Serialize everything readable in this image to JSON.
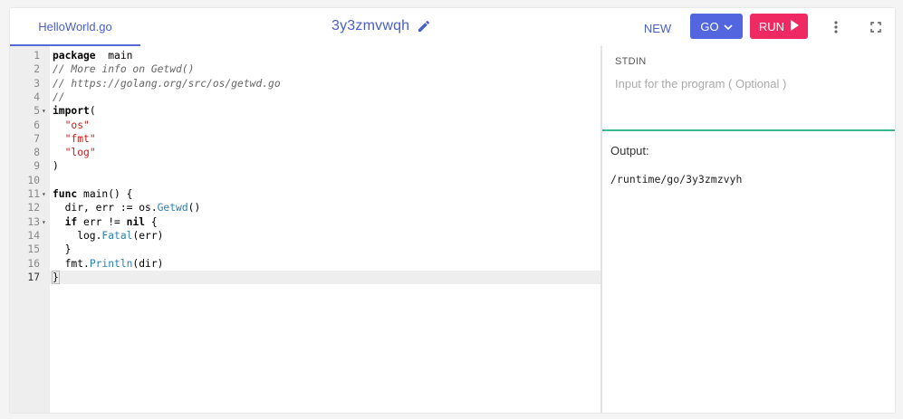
{
  "header": {
    "file_tab": "HelloWorld.go",
    "title": "3y3zmvwqh",
    "new_label": "NEW",
    "go_label": "GO",
    "run_label": "RUN"
  },
  "editor": {
    "active_line": 17,
    "lines": [
      {
        "n": "1",
        "fold": false,
        "tokens": [
          [
            "kw",
            "package"
          ],
          [
            "",
            "  main"
          ]
        ]
      },
      {
        "n": "2",
        "fold": false,
        "tokens": [
          [
            "cm",
            "// More info on Getwd()"
          ]
        ]
      },
      {
        "n": "3",
        "fold": false,
        "tokens": [
          [
            "cm",
            "// https://golang.org/src/os/getwd.go"
          ]
        ]
      },
      {
        "n": "4",
        "fold": false,
        "tokens": [
          [
            "cm",
            "//"
          ]
        ]
      },
      {
        "n": "5",
        "fold": true,
        "tokens": [
          [
            "kw",
            "import"
          ],
          [
            "",
            "("
          ]
        ]
      },
      {
        "n": "6",
        "fold": false,
        "tokens": [
          [
            "",
            "  "
          ],
          [
            "str",
            "\"os\""
          ]
        ]
      },
      {
        "n": "7",
        "fold": false,
        "tokens": [
          [
            "",
            "  "
          ],
          [
            "str",
            "\"fmt\""
          ]
        ]
      },
      {
        "n": "8",
        "fold": false,
        "tokens": [
          [
            "",
            "  "
          ],
          [
            "str",
            "\"log\""
          ]
        ]
      },
      {
        "n": "9",
        "fold": false,
        "tokens": [
          [
            "",
            ")"
          ]
        ]
      },
      {
        "n": "10",
        "fold": false,
        "tokens": []
      },
      {
        "n": "11",
        "fold": true,
        "tokens": [
          [
            "kw",
            "func"
          ],
          [
            "",
            " main() {"
          ]
        ]
      },
      {
        "n": "12",
        "fold": false,
        "tokens": [
          [
            "",
            "  dir, err := os."
          ],
          [
            "fn",
            "Getwd"
          ],
          [
            "",
            "()"
          ]
        ]
      },
      {
        "n": "13",
        "fold": true,
        "tokens": [
          [
            "",
            "  "
          ],
          [
            "kw",
            "if"
          ],
          [
            "",
            " err != "
          ],
          [
            "kw",
            "nil"
          ],
          [
            "",
            " {"
          ]
        ]
      },
      {
        "n": "14",
        "fold": false,
        "tokens": [
          [
            "",
            "    log."
          ],
          [
            "fn",
            "Fatal"
          ],
          [
            "",
            "(err)"
          ]
        ]
      },
      {
        "n": "15",
        "fold": false,
        "tokens": [
          [
            "",
            "  }"
          ]
        ]
      },
      {
        "n": "16",
        "fold": false,
        "tokens": [
          [
            "",
            "  fmt."
          ],
          [
            "fn",
            "Println"
          ],
          [
            "",
            "(dir)"
          ]
        ]
      },
      {
        "n": "17",
        "fold": false,
        "tokens": [
          [
            "brace",
            "}"
          ]
        ]
      }
    ]
  },
  "stdin": {
    "label": "STDIN",
    "placeholder": "Input for the program ( Optional )"
  },
  "output": {
    "label": "Output:",
    "text": "/runtime/go/3y3zmzvyh"
  },
  "colors": {
    "accent": "#5266e0",
    "run": "#ef2a63",
    "stdin_border": "#3cb890"
  },
  "icons": [
    "pencil-icon",
    "chevron-down-icon",
    "play-icon",
    "more-vertical-icon",
    "fullscreen-icon",
    "fold-arrow-icon"
  ]
}
